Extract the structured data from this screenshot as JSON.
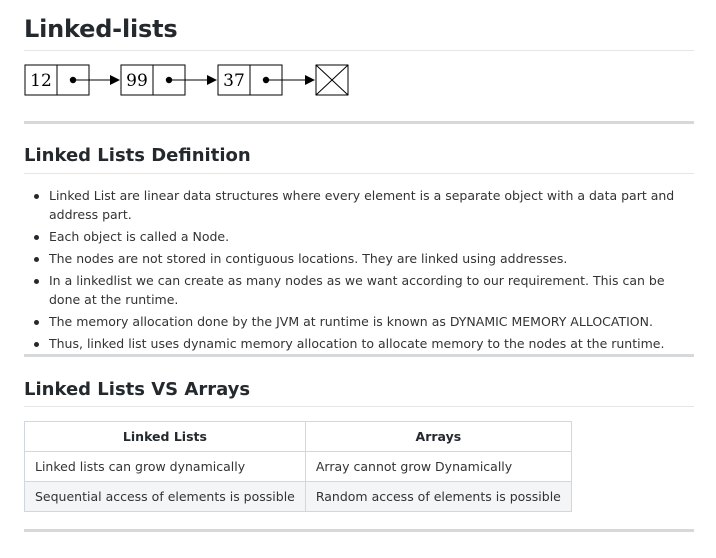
{
  "page": {
    "title": "Linked-lists"
  },
  "diagram": {
    "nodes": [
      "12",
      "99",
      "37"
    ],
    "terminal": "null-box"
  },
  "definition": {
    "heading": "Linked Lists Definition",
    "items": [
      "Linked List are linear data structures where every element is a separate object with a data part and address part.",
      "Each object is called a Node.",
      "The nodes are not stored in contiguous locations. They are linked using addresses.",
      "In a linkedlist we can create as many nodes as we want according to our requirement. This can be done at the runtime.",
      "The memory allocation done by the JVM at runtime is known as DYNAMIC MEMORY ALLOCATION.",
      "Thus, linked list uses dynamic memory allocation to allocate memory to the nodes at the runtime."
    ]
  },
  "comparison": {
    "heading": "Linked Lists VS Arrays",
    "headers": [
      "Linked Lists",
      "Arrays"
    ],
    "rows": [
      [
        "Linked lists can grow dynamically",
        "Array cannot grow Dynamically"
      ],
      [
        "Sequential access of elements is possible",
        "Random access of elements is possible"
      ]
    ]
  }
}
